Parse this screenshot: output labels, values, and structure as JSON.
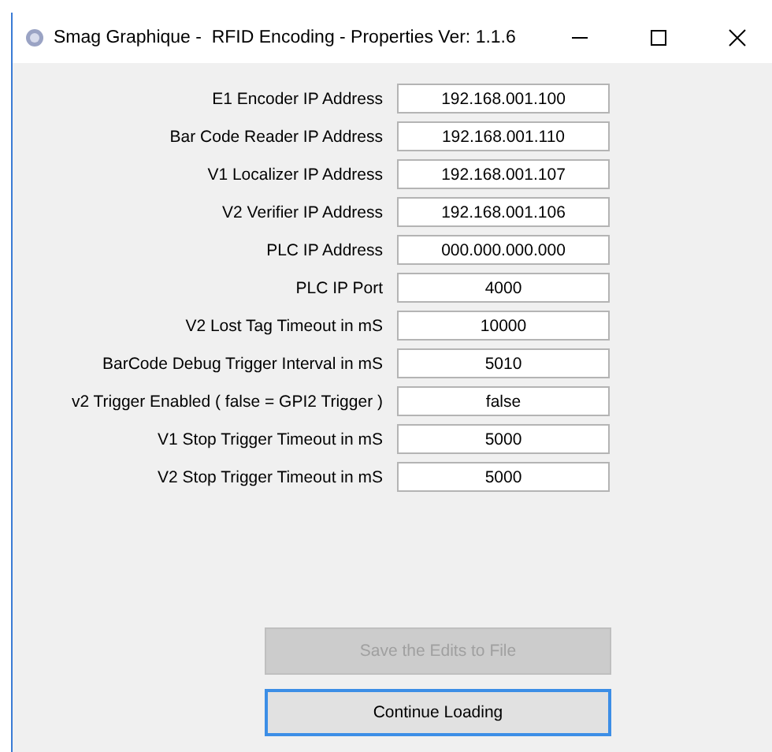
{
  "window": {
    "title": "Smag Graphique -  RFID Encoding - Properties Ver: 1.1.6"
  },
  "fields": [
    {
      "label": "E1 Encoder IP Address",
      "value": "192.168.001.100"
    },
    {
      "label": "Bar Code Reader IP Address",
      "value": "192.168.001.110"
    },
    {
      "label": "V1 Localizer IP Address",
      "value": "192.168.001.107"
    },
    {
      "label": "V2 Verifier IP Address",
      "value": "192.168.001.106"
    },
    {
      "label": "PLC IP Address",
      "value": "000.000.000.000"
    },
    {
      "label": "PLC IP Port",
      "value": "4000"
    },
    {
      "label": "V2 Lost Tag Timeout in mS",
      "value": "10000"
    },
    {
      "label": "BarCode Debug Trigger Interval in mS",
      "value": "5010"
    },
    {
      "label": "v2 Trigger Enabled ( false = GPI2 Trigger )",
      "value": "false"
    },
    {
      "label": "V1 Stop Trigger Timeout in mS",
      "value": "5000"
    },
    {
      "label": "V2 Stop Trigger Timeout in mS",
      "value": "5000"
    }
  ],
  "buttons": [
    {
      "label": "Save the Edits to File",
      "disabled": true,
      "focused": false
    },
    {
      "label": "Continue Loading",
      "disabled": false,
      "focused": true
    }
  ]
}
